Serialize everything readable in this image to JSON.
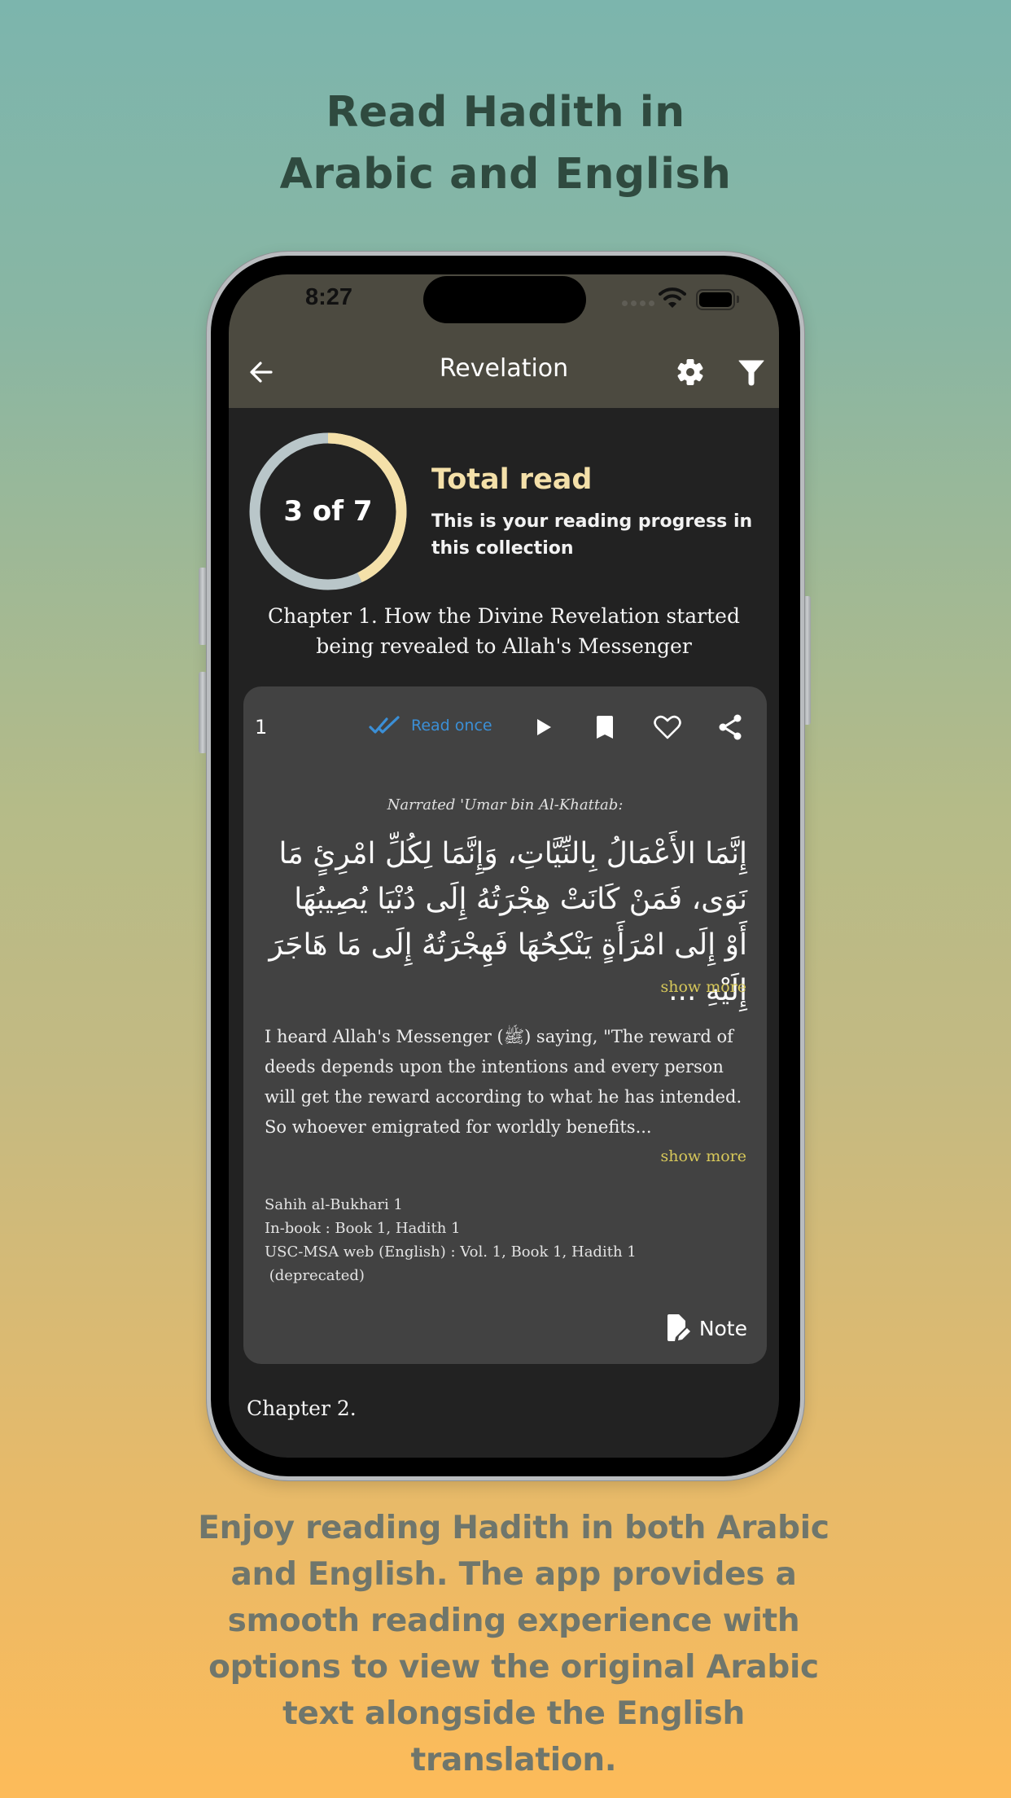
{
  "promo": {
    "headline_lines": [
      "Read Hadith in",
      "Arabic and English"
    ],
    "description": "Enjoy reading Hadith in both Arabic and English. The app provides a smooth reading experience with options to view the original Arabic text alongside the English translation."
  },
  "status_bar": {
    "time": "8:27",
    "icons": [
      "signal-icon",
      "wifi-icon",
      "battery-icon"
    ]
  },
  "app_bar": {
    "title": "Revelation",
    "back_icon": "arrow-left-icon",
    "actions": [
      "gear-icon",
      "filter-icon"
    ]
  },
  "progress": {
    "read": 3,
    "total": 7,
    "label": "3 of 7",
    "title": "Total read",
    "subtitle": "This is your reading progress in this collection",
    "colors": {
      "done": "#f4e0a9",
      "remaining": "#b9c6c9"
    }
  },
  "chapters": [
    {
      "title": "Chapter 1. How the Divine Revelation started being revealed to Allah's Messenger"
    },
    {
      "title": "Chapter 2."
    }
  ],
  "hadith": {
    "number": "1",
    "read_status": "Read once",
    "actions": [
      "play-icon",
      "bookmark-icon",
      "heart-icon",
      "share-icon"
    ],
    "narrator": "Narrated 'Umar bin Al-Khattab:",
    "arabic": "إِنَّمَا الأَعْمَالُ بِالنِّيَّاتِ، وَإِنَّمَا لِكُلِّ امْرِئٍ مَا نَوَى، فَمَنْ كَانَتْ هِجْرَتُهُ إِلَى دُنْيَا يُصِيبُهَا أَوْ إِلَى امْرَأَةٍ يَنْكِحُهَا فَهِجْرَتُهُ إِلَى مَا هَاجَرَ إِلَيْهِ ...",
    "arabic_show_more": "show more",
    "english": "I heard Allah's Messenger (ﷺ) saying, \"The reward of deeds depends upon the intentions and every person will get the reward according to what he has intended. So whoever emigrated for worldly benefits...",
    "english_show_more": "show more",
    "references": [
      "Sahih al-Bukhari 1",
      "In-book : Book 1, Hadith 1",
      "USC-MSA web (English) : Vol. 1, Book 1, Hadith 1",
      " (deprecated)"
    ],
    "note_label": "Note",
    "colors": {
      "read_status": "#3b8fd6",
      "show_more": "#d7c85a"
    }
  }
}
